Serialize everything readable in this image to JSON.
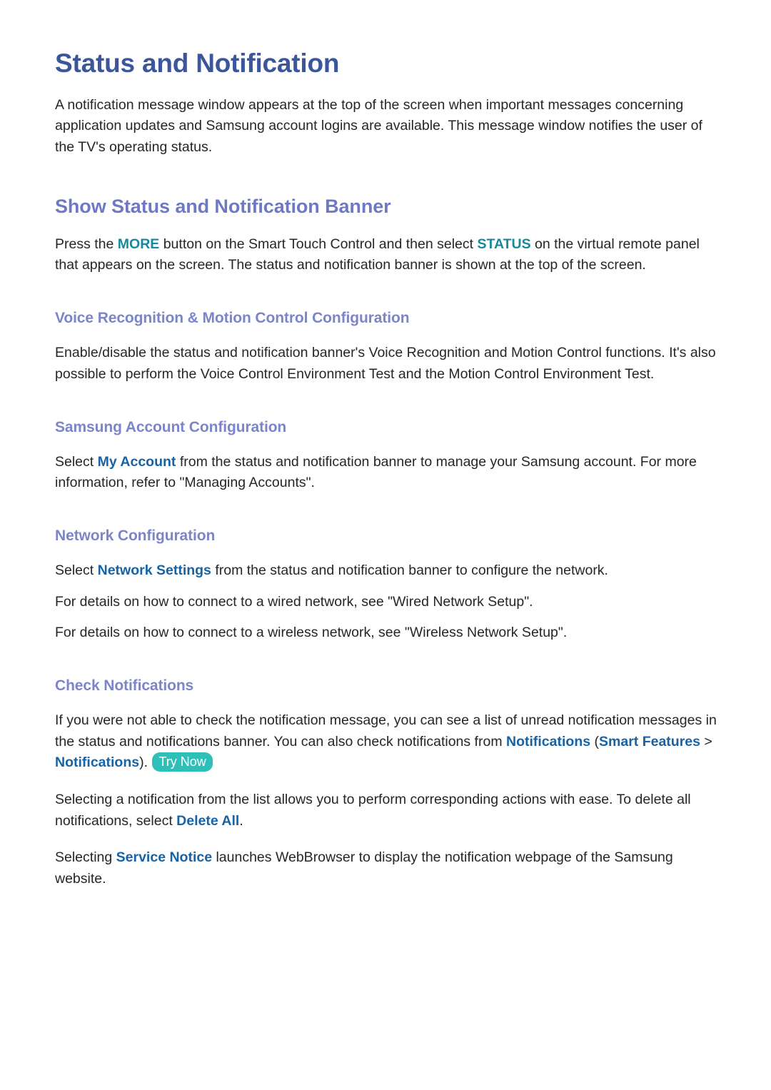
{
  "document": {
    "title": "Status and Notification",
    "intro": "A notification message window appears at the top of the screen when important messages concerning application updates and Samsung account logins are available. This message window notifies the user of the TV's operating status.",
    "section": {
      "title": "Show Status and Notification Banner",
      "intro_before_more": "Press the ",
      "more_label": "MORE",
      "intro_between": " button on the Smart Touch Control and then select ",
      "status_label": "STATUS",
      "intro_after_status": " on the virtual remote panel that appears on the screen. The status and notification banner is shown at the top of the screen."
    },
    "subsections": [
      {
        "title": "Voice Recognition & Motion Control Configuration",
        "paragraph": "Enable/disable the status and notification banner's Voice Recognition and Motion Control functions. It's also possible to perform the Voice Control Environment Test and the Motion Control Environment Test."
      },
      {
        "title": "Samsung Account Configuration",
        "before_link": "Select ",
        "link_label": "My Account",
        "after_link": " from the status and notification banner to manage your Samsung account. For more information, refer to \"Managing Accounts\"."
      },
      {
        "title": "Network Configuration",
        "before_link": "Select ",
        "link_label": "Network Settings",
        "after_link": " from the status and notification banner to configure the network.",
        "wired_line": "For details on how to connect to a wired network, see \"Wired Network Setup\".",
        "wireless_line": "For details on how to connect to a wireless network, see \"Wireless Network Setup\"."
      },
      {
        "title": "Check Notifications",
        "para1_before": "If you were not able to check the notification message, you can see a list of unread notification messages in the status and notifications banner. You can also check notifications from ",
        "para1_link_notifications": "Notifications",
        "para1_mid_open": " (",
        "para1_link_smart_features": "Smart Features",
        "para1_chevron": " > ",
        "para1_link_notifications2": "Notifications",
        "para1_mid_close": "). ",
        "try_now_badge": "Try Now",
        "para2_before": "Selecting a notification from the list allows you to perform corresponding actions with ease. To delete all notifications, select ",
        "para2_link": "Delete All",
        "para2_after": ".",
        "para3_before": "Selecting ",
        "para3_link": "Service Notice",
        "para3_after": " launches WebBrowser to display the notification webpage of the Samsung website."
      }
    ]
  },
  "colors": {
    "title_blue": "#3c569c",
    "heading_purple": "#6e79c6",
    "subheading_purple": "#7b85ca",
    "highlight_teal": "#16899b",
    "highlight_blue": "#1763a6",
    "badge_turquoise": "#2ec0b8",
    "body_text": "#262626",
    "page_background": "#ffffff"
  }
}
